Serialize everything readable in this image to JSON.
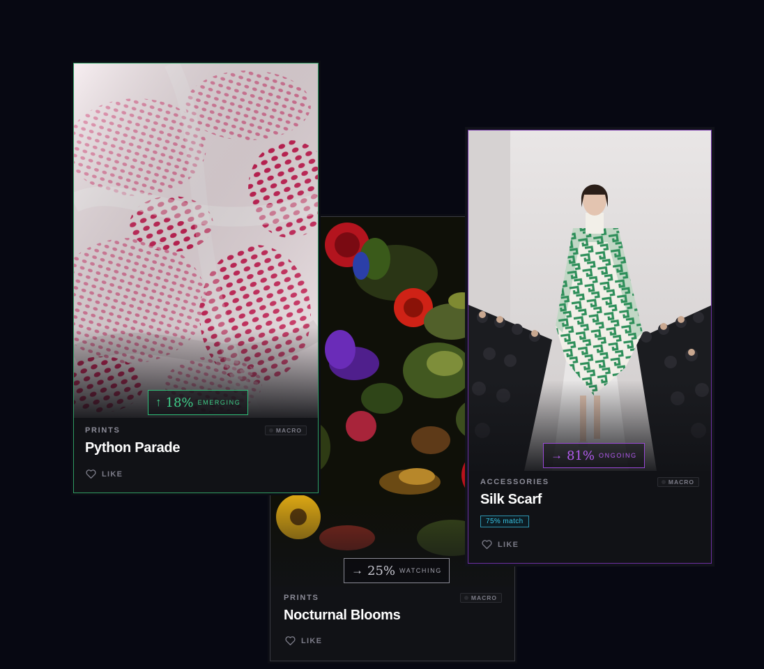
{
  "cards": [
    {
      "id": "python-parade",
      "category": "PRINTS",
      "scale": "MACRO",
      "title": "Python Parade",
      "trend": {
        "arrow": "↑",
        "percent": "18%",
        "status": "EMERGING",
        "color": "#3fd08a"
      },
      "like_label": "LIKE",
      "border_color": "#2f9c63"
    },
    {
      "id": "nocturnal-blooms",
      "category": "PRINTS",
      "scale": "MACRO",
      "title": "Nocturnal Blooms",
      "trend": {
        "arrow": "→",
        "percent": "25%",
        "status": "WATCHING",
        "color": "#b9b9c4"
      },
      "like_label": "LIKE",
      "border_color": "#3a3b42"
    },
    {
      "id": "silk-scarf",
      "category": "ACCESSORIES",
      "scale": "MACRO",
      "title": "Silk Scarf",
      "match": "75% match",
      "trend": {
        "arrow": "→",
        "percent": "81%",
        "status": "ONGOING",
        "color": "#b35cf0"
      },
      "like_label": "LIKE",
      "border_color": "#6d2fa3"
    }
  ]
}
